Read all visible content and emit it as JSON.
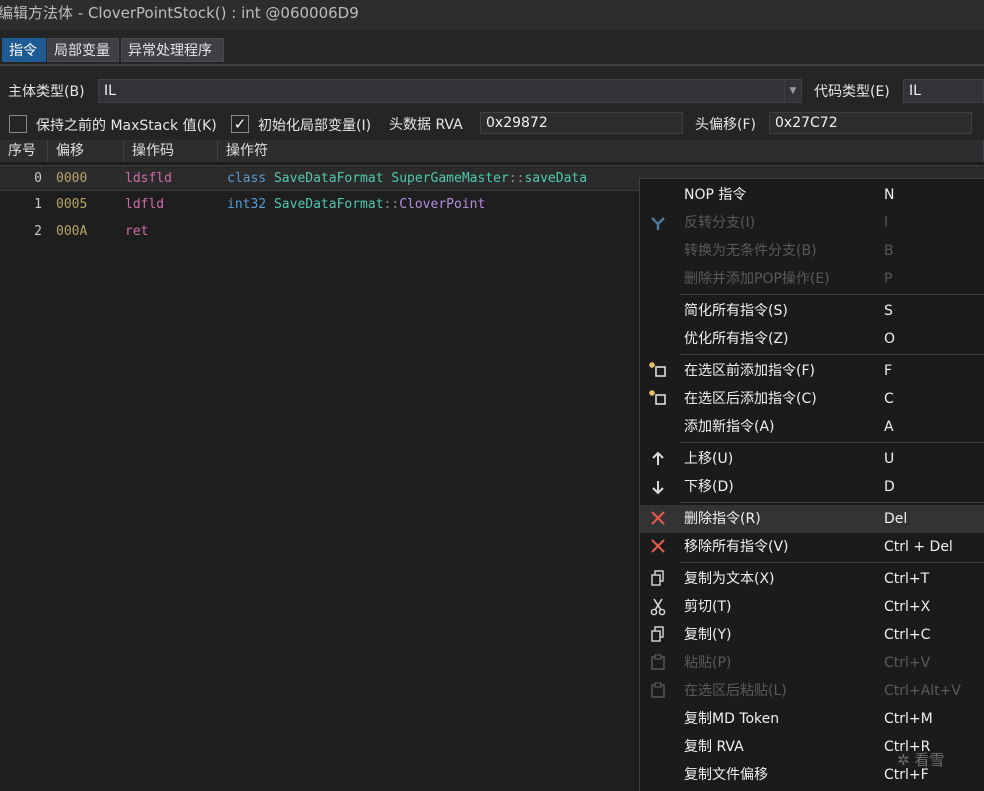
{
  "window": {
    "title": "编辑方法体 - CloverPointStock() : int @060006D9"
  },
  "tabs": [
    {
      "label": "指令",
      "active": true
    },
    {
      "label": "局部变量",
      "active": false
    },
    {
      "label": "异常处理程序",
      "active": false
    }
  ],
  "form": {
    "body_type_label": "主体类型(B)",
    "body_type_value": "IL",
    "code_type_label": "代码类型(E)",
    "code_type_value": "IL",
    "keep_maxstack_label": "保持之前的 MaxStack 值(K)",
    "keep_maxstack_checked": false,
    "init_locals_label": "初始化局部变量(I)",
    "init_locals_checked": true,
    "init_locals_mark": "✓",
    "header_rva_label": "头数据 RVA",
    "header_rva_value": "0x29872",
    "header_offset_label": "头偏移(F)",
    "header_offset_value": "0x27C72"
  },
  "grid": {
    "columns": [
      "序号",
      "偏移",
      "操作码",
      "操作符"
    ],
    "rows": [
      {
        "index": "0",
        "offset": "0000",
        "opcode": "ldsfld",
        "kw": "class",
        "type": "SaveDataFormat",
        "owner": "SuperGameMaster",
        "sep": "::",
        "member": "saveData",
        "selected": true
      },
      {
        "index": "1",
        "offset": "0005",
        "opcode": "ldfld",
        "kw": "int32",
        "type": "SaveDataFormat",
        "owner": "",
        "sep": "::",
        "member": "CloverPoint",
        "selected": false
      },
      {
        "index": "2",
        "offset": "000A",
        "opcode": "ret",
        "kw": "",
        "type": "",
        "owner": "",
        "sep": "",
        "member": "",
        "selected": false
      }
    ]
  },
  "context_menu": {
    "items": [
      {
        "label": "NOP 指令",
        "shortcut": "N",
        "icon": "",
        "disabled": false
      },
      {
        "label": "反转分支(I)",
        "shortcut": "I",
        "icon": "branch-icon",
        "disabled": true
      },
      {
        "label": "转换为无条件分支(B)",
        "shortcut": "B",
        "icon": "",
        "disabled": true
      },
      {
        "label": "删除并添加POP操作(E)",
        "shortcut": "P",
        "icon": "",
        "disabled": true
      },
      {
        "label": "简化所有指令(S)",
        "shortcut": "S",
        "icon": "",
        "disabled": false
      },
      {
        "label": "优化所有指令(Z)",
        "shortcut": "O",
        "icon": "",
        "disabled": false
      },
      {
        "label": "在选区前添加指令(F)",
        "shortcut": "F",
        "icon": "insert-before-icon",
        "disabled": false
      },
      {
        "label": "在选区后添加指令(C)",
        "shortcut": "C",
        "icon": "insert-after-icon",
        "disabled": false
      },
      {
        "label": "添加新指令(A)",
        "shortcut": "A",
        "icon": "",
        "disabled": false
      },
      {
        "label": "上移(U)",
        "shortcut": "U",
        "icon": "arrow-up-icon",
        "disabled": false
      },
      {
        "label": "下移(D)",
        "shortcut": "D",
        "icon": "arrow-down-icon",
        "disabled": false
      },
      {
        "label": "删除指令(R)",
        "shortcut": "Del",
        "icon": "delete-icon",
        "disabled": false,
        "highlighted": true
      },
      {
        "label": "移除所有指令(V)",
        "shortcut": "Ctrl + Del",
        "icon": "delete-icon",
        "disabled": false
      },
      {
        "label": "复制为文本(X)",
        "shortcut": "Ctrl+T",
        "icon": "copy-icon",
        "disabled": false
      },
      {
        "label": "剪切(T)",
        "shortcut": "Ctrl+X",
        "icon": "cut-icon",
        "disabled": false
      },
      {
        "label": "复制(Y)",
        "shortcut": "Ctrl+C",
        "icon": "copy-icon",
        "disabled": false
      },
      {
        "label": "粘贴(P)",
        "shortcut": "Ctrl+V",
        "icon": "paste-icon",
        "disabled": true
      },
      {
        "label": "在选区后粘贴(L)",
        "shortcut": "Ctrl+Alt+V",
        "icon": "paste-icon",
        "disabled": true
      },
      {
        "label": "复制MD Token",
        "shortcut": "Ctrl+M",
        "icon": "",
        "disabled": false
      },
      {
        "label": "复制 RVA",
        "shortcut": "Ctrl+R",
        "icon": "",
        "disabled": false
      },
      {
        "label": "复制文件偏移",
        "shortcut": "Ctrl+F",
        "icon": "",
        "disabled": false
      }
    ]
  },
  "watermark": {
    "text": "看雪"
  },
  "colors": {
    "background": "#252526",
    "grid_background": "#1e1e1e",
    "active_tab": "#1e5b93",
    "opcode": "#d16ba8",
    "offset": "#b5a36a",
    "keyword": "#569cd6",
    "type": "#4ec9b0",
    "member": "#b48ee0",
    "delete_icon": "#e05a47"
  }
}
